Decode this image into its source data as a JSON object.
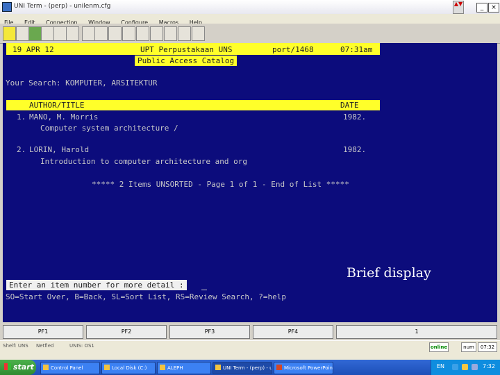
{
  "window": {
    "title": "UNI Term - (perp) - unilenm.cfg",
    "min_glyph": "_",
    "close_glyph": "×",
    "scroll_glyph": "▲▼"
  },
  "menu": [
    "File",
    "Edit",
    "Connection",
    "Window",
    "Configure",
    "Macros",
    "Help"
  ],
  "terminal": {
    "date": "19 APR 12",
    "library_name": "UPT Perpustakaan UNS",
    "terminal_id": "port/1468",
    "time": "07:31am",
    "catalog_name": "Public Access Catalog",
    "search": "Your Search: KOMPUTER, ARSITEKTUR",
    "col_author_title": "AUTHOR/TITLE",
    "col_date": "DATE",
    "results": [
      {
        "num": "1.",
        "author": "MANO, M. Morris",
        "date": "1982.",
        "title": "Computer system architecture /"
      },
      {
        "num": "2.",
        "author": "LORIN, Harold",
        "date": "1982.",
        "title": "Introduction to computer architecture and org"
      }
    ],
    "summary": "***** 2 Items UNSORTED - Page 1 of 1 - End of List *****",
    "prompt": "Enter an item number for more detail :",
    "commands": "SO=Start Over, B=Back, SL=Sort List, RS=Review Search, ?=help",
    "overlay_caption": "Brief display"
  },
  "pf_keys": [
    "PF1",
    "PF2",
    "PF3",
    "PF4",
    "1"
  ],
  "status": {
    "left": "Shelf: UNS",
    "mid": "Netfied",
    "mid2": "UNIS: OS1",
    "online": "online",
    "num": "num",
    "clock": "07:32"
  },
  "taskbar": {
    "start": "start",
    "tasks": [
      "Control Panel",
      "Local Disk (C:)",
      "ALEPH",
      "UNI Term - (perp) - uni...",
      "Microsoft PowerPoint..."
    ],
    "tray_lang": "EN",
    "tray_time": "7:32"
  }
}
